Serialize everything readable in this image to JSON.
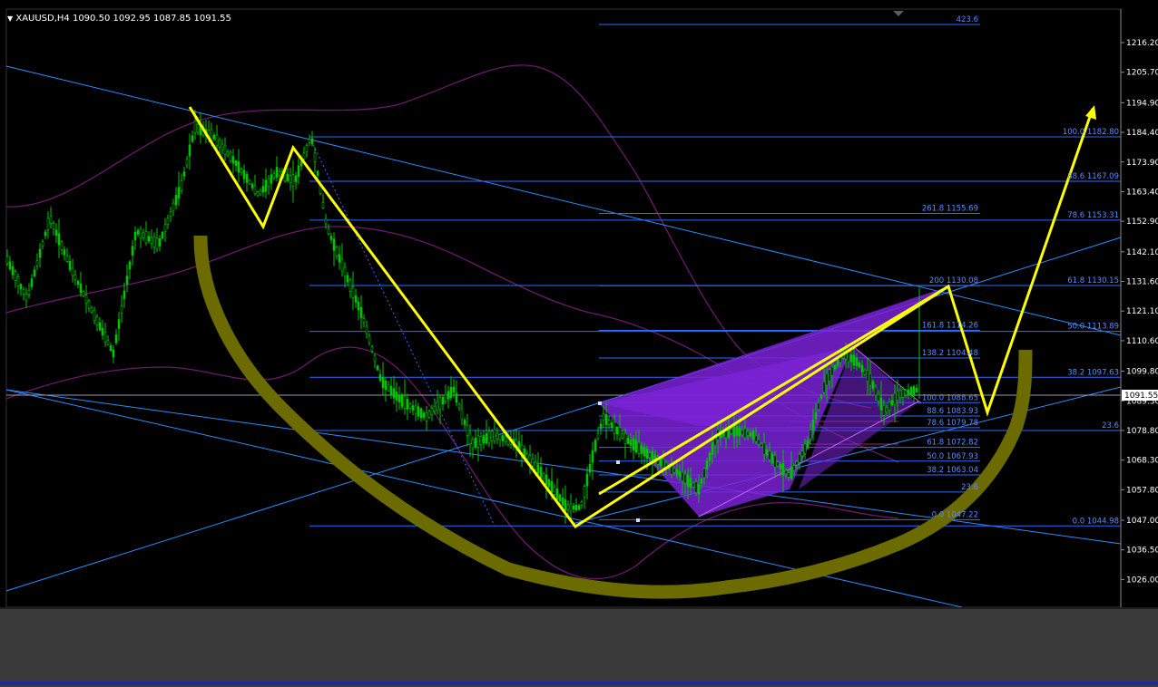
{
  "window": {
    "symbol_line": "XAUUSD,H4  1090.50 1092.95 1087.85 1091.55",
    "menu_arrow": "chevron-down-icon"
  },
  "colors": {
    "background": "#000000",
    "bull_candle": "#00c400",
    "trendline": "#2d8cff",
    "fib_line": "#2d6bff",
    "zigzag": "#ffff00",
    "bowl": "#6b6b00",
    "harmonic_fill": "#7a22d6",
    "envelope": "#6a1a6a",
    "price_tag_bg": "#ffffff",
    "bottom_panel": "#3a3a3a"
  },
  "chart_data": {
    "type": "line",
    "title": "XAUUSD,H4",
    "ohlc_header": {
      "open": 1090.5,
      "high": 1092.95,
      "low": 1087.85,
      "close": 1091.55
    },
    "current_price_label": "1091.55",
    "current_price": 1091.55,
    "ylim": [
      1019.0,
      1222.0
    ],
    "y_ticks": [
      "1216.20",
      "1205.70",
      "1194.90",
      "1184.40",
      "1173.90",
      "1163.40",
      "1152.90",
      "1142.10",
      "1131.60",
      "1121.10",
      "1110.60",
      "1099.80",
      "1089.30",
      "1078.80",
      "1068.30",
      "1057.80",
      "1047.00",
      "1036.50",
      "1026.00"
    ],
    "grid": false,
    "top_marker_label": "423.6",
    "fib_levels_right": [
      {
        "label": "100.0 1182.80",
        "price": 1182.8
      },
      {
        "label": "88.6 1167.09",
        "price": 1167.09
      },
      {
        "label": "78.6 1153.31",
        "price": 1153.31
      },
      {
        "label": "61.8 1130.15",
        "price": 1130.15
      },
      {
        "label": "50.0 1113.89",
        "price": 1113.89
      },
      {
        "label": "38.2 1097.63",
        "price": 1097.63
      },
      {
        "label": "23.6",
        "price": 1078.8
      },
      {
        "label": "0.0 1044.98",
        "price": 1044.98
      }
    ],
    "fib_levels_mid": [
      {
        "label": "261.8 1155.69",
        "price": 1155.69
      },
      {
        "label": "200 1130.08",
        "price": 1130.08
      },
      {
        "label": "161.8 1114.26",
        "price": 1114.26
      },
      {
        "label": "138.2 1104.48",
        "price": 1104.48
      },
      {
        "label": "100.0 1088.65",
        "price": 1088.65
      },
      {
        "label": "88.6 1083.93",
        "price": 1083.93
      },
      {
        "label": "78.6 1079.78",
        "price": 1079.78
      },
      {
        "label": "61.8 1072.82",
        "price": 1072.82
      },
      {
        "label": "50.0 1067.93",
        "price": 1067.93
      },
      {
        "label": "38.2 1063.04",
        "price": 1063.04
      },
      {
        "label": "23.6",
        "price": 1057.0
      },
      {
        "label": "0.0 1047.22",
        "price": 1047.22
      }
    ],
    "series": [
      {
        "values": [
          1184.5,
          1156.0,
          1175.0,
          1045.5,
          1088.0,
          1130.0,
          1085.5,
          1192.0
        ]
      },
      {
        "values": [
          1152,
          1110,
          1090,
          1062,
          1044,
          1038,
          1032,
          1030,
          1031,
          1034,
          1040,
          1048,
          1060,
          1082,
          1107
        ]
      }
    ]
  }
}
